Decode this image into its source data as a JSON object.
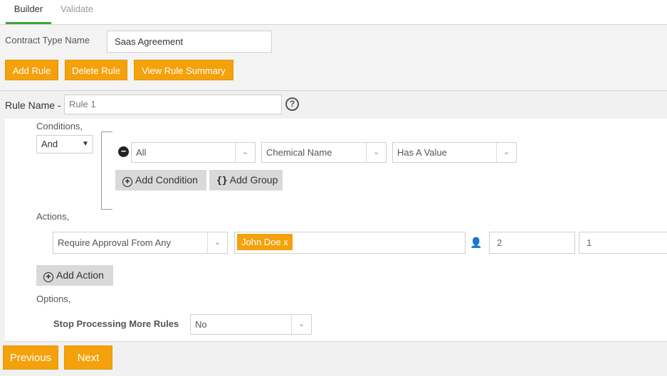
{
  "tabs": [
    {
      "label": "Builder",
      "active": true
    },
    {
      "label": "Validate",
      "active": false
    }
  ],
  "contract_type": {
    "label": "Contract Type Name",
    "value": "Saas Agreement"
  },
  "toolbar": {
    "add_rule": "Add Rule",
    "delete_rule": "Delete Rule",
    "view_summary": "View Rule Summary"
  },
  "rule": {
    "label": "Rule Name -",
    "value": "Rule 1",
    "help": "?"
  },
  "conditions": {
    "label": "Conditions,",
    "operator": "And",
    "row": {
      "field1": "All",
      "field2": "Chemical Name",
      "field3": "Has A Value"
    },
    "add_condition": "Add Condition",
    "add_group": "Add Group"
  },
  "actions": {
    "label": "Actions,",
    "approval_type": "Require Approval From Any",
    "user_tag": "John Doe x",
    "count1": "2",
    "count2": "1",
    "add_action": "Add Action"
  },
  "options": {
    "label": "Options,",
    "stop_label": "Stop Processing More Rules",
    "stop_value": "No"
  },
  "footer": {
    "previous": "Previous",
    "next": "Next"
  },
  "colors": {
    "accent": "#f4a10b",
    "active_tab": "#3aa53a"
  }
}
